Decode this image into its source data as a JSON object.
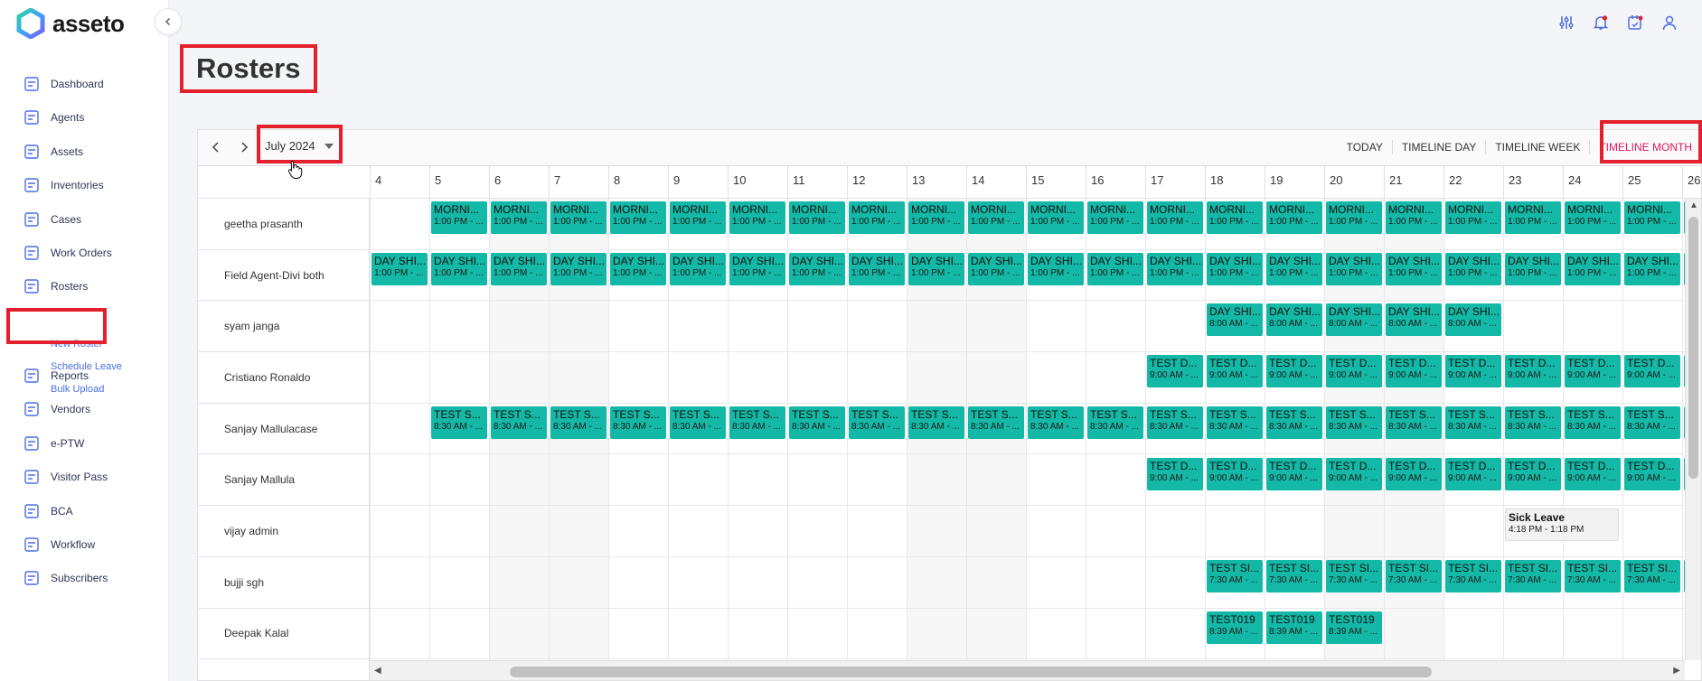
{
  "app": {
    "name": "asseto",
    "page_title": "Rosters"
  },
  "sidebar": {
    "items": [
      {
        "label": "Dashboard",
        "icon": "dashboard-icon"
      },
      {
        "label": "Agents",
        "icon": "agents-icon"
      },
      {
        "label": "Assets",
        "icon": "assets-icon"
      },
      {
        "label": "Inventories",
        "icon": "inventories-icon"
      },
      {
        "label": "Cases",
        "icon": "cases-icon"
      },
      {
        "label": "Work Orders",
        "icon": "work-orders-icon"
      },
      {
        "label": "Rosters",
        "icon": "rosters-icon",
        "active": true
      },
      {
        "label": "Reports",
        "icon": "reports-icon"
      },
      {
        "label": "Vendors",
        "icon": "vendors-icon"
      },
      {
        "label": "e-PTW",
        "icon": "eptw-icon"
      },
      {
        "label": "Visitor Pass",
        "icon": "visitor-pass-icon"
      },
      {
        "label": "BCA",
        "icon": "bca-icon"
      },
      {
        "label": "Workflow",
        "icon": "workflow-icon"
      },
      {
        "label": "Subscribers",
        "icon": "subscribers-icon"
      }
    ],
    "sub_items": [
      "New Roster",
      "Schedule Leave",
      "Bulk Upload"
    ]
  },
  "topbar": {
    "icons": [
      "filter-sliders-icon",
      "notification-bell-icon",
      "task-calendar-icon",
      "user-profile-icon"
    ]
  },
  "scheduler": {
    "date_label": "July 2024",
    "views": [
      {
        "label": "TODAY"
      },
      {
        "label": "TIMELINE DAY"
      },
      {
        "label": "TIMELINE WEEK"
      },
      {
        "label": "TIMELINE MONTH",
        "active": true
      }
    ],
    "days": [
      "4",
      "5",
      "6",
      "7",
      "8",
      "9",
      "10",
      "11",
      "12",
      "13",
      "14",
      "15",
      "16",
      "17",
      "18",
      "19",
      "20",
      "21",
      "22",
      "23",
      "24",
      "25",
      "26"
    ],
    "weekend_days": [
      "6",
      "7",
      "13",
      "14",
      "20",
      "21"
    ],
    "resources": [
      "geetha prasanth",
      "Field Agent-Divi both",
      "syam janga",
      "Cristiano Ronaldo",
      "Sanjay Mallulacase",
      "Sanjay Mallula",
      "vijay admin",
      "bujji sgh",
      "Deepak Kalal"
    ],
    "events": [
      {
        "row": 0,
        "from": 1,
        "to": 22,
        "title": "MORNI...",
        "time": "1:00 PM - ..."
      },
      {
        "row": 1,
        "from": 0,
        "to": 22,
        "title": "DAY SHI...",
        "time": "1:00 PM - ..."
      },
      {
        "row": 2,
        "from": 14,
        "to": 18,
        "title": "DAY SHI...",
        "time": "8:00 AM - ..."
      },
      {
        "row": 3,
        "from": 13,
        "to": 22,
        "title": "TEST D...",
        "time": "9:00 AM - ..."
      },
      {
        "row": 4,
        "from": 1,
        "to": 22,
        "title": "TEST S...",
        "time": "8:30 AM - ..."
      },
      {
        "row": 5,
        "from": 13,
        "to": 22,
        "title": "TEST D...",
        "time": "9:00 AM - ..."
      },
      {
        "row": 7,
        "from": 14,
        "to": 22,
        "title": "TEST SI...",
        "time": "7:30 AM - ..."
      },
      {
        "row": 8,
        "from": 14,
        "to": 16,
        "title": "TEST019",
        "time": "8:39 AM - ..."
      },
      {
        "row": 9,
        "from": 14,
        "to": 22,
        "title": "",
        "time": ""
      }
    ],
    "leave": {
      "row": 6,
      "day_index": 19,
      "title": "Sick Leave",
      "time": "4:18 PM - 1:18 PM"
    }
  },
  "colors": {
    "event": "#14b8a6",
    "accent": "#4a6de5",
    "active_view": "#e3165b",
    "highlight": "#e3202b"
  }
}
